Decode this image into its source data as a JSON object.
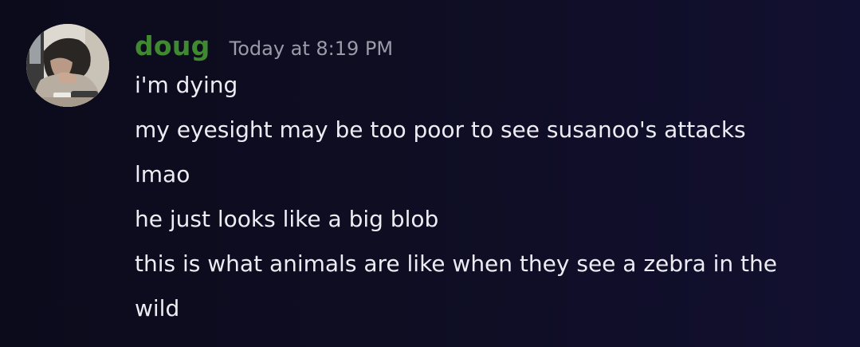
{
  "message": {
    "author": "doug",
    "author_color": "#3f8a31",
    "timestamp": "Today at 8:19 PM",
    "avatar_icon": "user-avatar-photo",
    "lines": [
      "i'm dying",
      "my eyesight may be too poor to see susanoo's attacks",
      "lmao",
      "he just looks like a big blob",
      "this is what animals are like when they see a zebra in the wild"
    ]
  }
}
